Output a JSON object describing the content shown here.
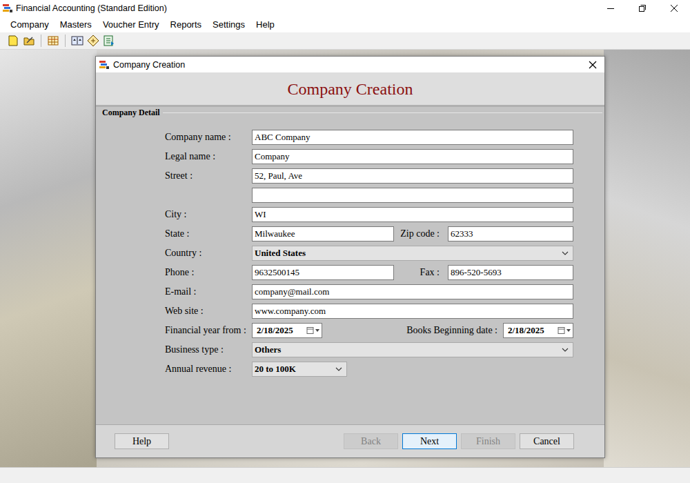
{
  "window": {
    "title": "Financial Accounting (Standard Edition)"
  },
  "menu": [
    "Company",
    "Masters",
    "Voucher Entry",
    "Reports",
    "Settings",
    "Help"
  ],
  "dialog": {
    "title": "Company Creation",
    "heading": "Company Creation",
    "section": "Company Detail",
    "rows": [
      {
        "kind": "text",
        "label": "Company name :",
        "value": "ABC Company"
      },
      {
        "kind": "text",
        "label": "Legal name :",
        "value": "Company"
      },
      {
        "kind": "text",
        "label": "Street :",
        "value": "52, Paul, Ave"
      },
      {
        "kind": "text",
        "label": "",
        "value": ""
      },
      {
        "kind": "text",
        "label": "City :",
        "value": "WI"
      },
      {
        "kind": "pair",
        "label": "State :",
        "value": "Milwaukee",
        "label2": "Zip code :",
        "value2": "62333"
      },
      {
        "kind": "select",
        "label": "Country :",
        "value": "United States"
      },
      {
        "kind": "pair",
        "label": "Phone :",
        "value": "9632500145",
        "label2": "Fax :",
        "value2": "896-520-5693"
      },
      {
        "kind": "text",
        "label": "E-mail :",
        "value": "company@mail.com"
      },
      {
        "kind": "text",
        "label": "Web site :",
        "value": "www.company.com"
      },
      {
        "kind": "dates",
        "label": "Financial year from :",
        "value": "2/18/2025",
        "label2": "Books Beginning date :",
        "value2": "2/18/2025"
      },
      {
        "kind": "select",
        "label": "Business type :",
        "value": "Others"
      },
      {
        "kind": "short-select",
        "label": "Annual revenue :",
        "value": "20 to 100K"
      }
    ],
    "buttons": [
      {
        "label": "Help",
        "disabled": false,
        "focused": false
      },
      {
        "label": "Back",
        "disabled": true,
        "focused": false
      },
      {
        "label": "Next",
        "disabled": false,
        "focused": true
      },
      {
        "label": "Finish",
        "disabled": true,
        "focused": false
      },
      {
        "label": "Cancel",
        "disabled": false,
        "focused": false
      }
    ]
  }
}
